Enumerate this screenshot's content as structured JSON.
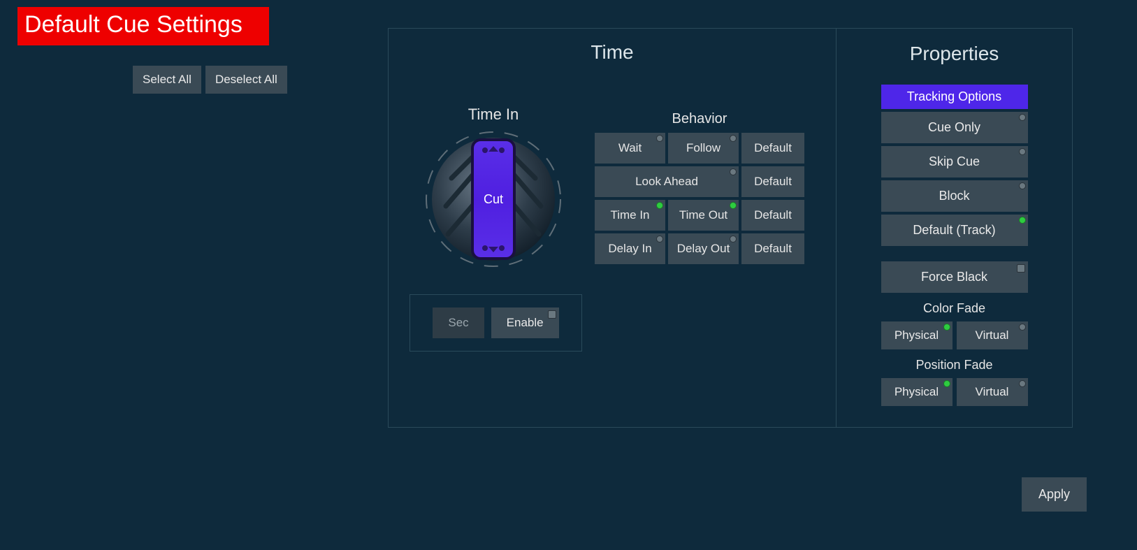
{
  "title": "Default Cue Settings",
  "selection": {
    "select_all": "Select All",
    "deselect_all": "Deselect All"
  },
  "sections": {
    "time": "Time",
    "properties": "Properties"
  },
  "wheel": {
    "label": "Time In",
    "center": "Cut"
  },
  "sec_enable": {
    "sec": "Sec",
    "enable": "Enable"
  },
  "behavior": {
    "title": "Behavior",
    "rows": [
      {
        "cells": [
          "Wait",
          "Follow"
        ],
        "default": "Default",
        "dots": [
          "off",
          "off"
        ]
      },
      {
        "cells": [
          "Look Ahead"
        ],
        "default": "Default",
        "dots": [
          "off"
        ]
      },
      {
        "cells": [
          "Time In",
          "Time Out"
        ],
        "default": "Default",
        "dots": [
          "on",
          "on"
        ]
      },
      {
        "cells": [
          "Delay In",
          "Delay Out"
        ],
        "default": "Default",
        "dots": [
          "off",
          "off"
        ]
      }
    ]
  },
  "properties": {
    "tracking_header": "Tracking Options",
    "tracking_options": [
      {
        "label": "Cue Only",
        "dot": "off"
      },
      {
        "label": "Skip Cue",
        "dot": "off"
      },
      {
        "label": "Block",
        "dot": "off"
      },
      {
        "label": "Default (Track)",
        "dot": "on"
      }
    ],
    "force_black": "Force Black",
    "color_fade": {
      "title": "Color Fade",
      "physical": "Physical",
      "virtual": "Virtual",
      "physical_dot": "on",
      "virtual_dot": "off"
    },
    "position_fade": {
      "title": "Position Fade",
      "physical": "Physical",
      "virtual": "Virtual",
      "physical_dot": "on",
      "virtual_dot": "off"
    }
  },
  "apply": "Apply"
}
